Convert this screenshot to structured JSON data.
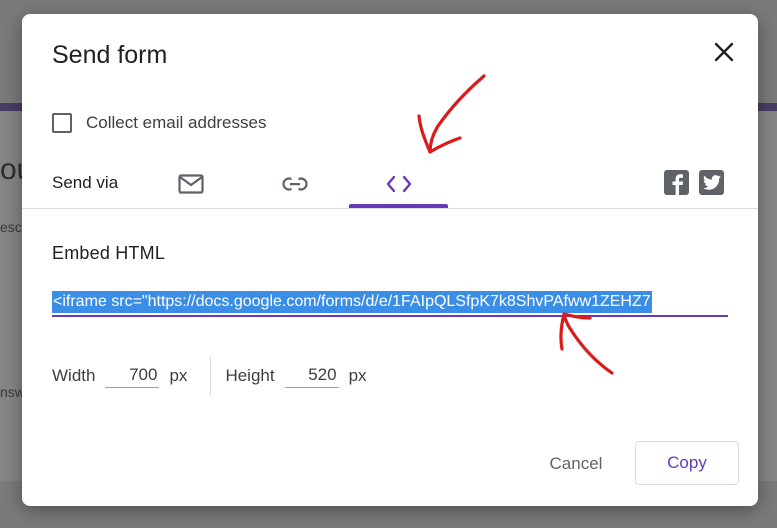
{
  "background": {
    "heading_fragment": "ou",
    "field_fragment_1": "esc",
    "field_fragment_2": "nsw"
  },
  "dialog": {
    "title": "Send form",
    "close_icon": "close-icon",
    "collect_email_label": "Collect email addresses",
    "collect_email_checked": false,
    "send_via_label": "Send via",
    "tabs": [
      {
        "icon": "email-icon",
        "selected": false
      },
      {
        "icon": "link-icon",
        "selected": false
      },
      {
        "icon": "code-icon",
        "selected": true
      }
    ],
    "social": [
      {
        "icon": "facebook-icon"
      },
      {
        "icon": "twitter-icon"
      }
    ],
    "embed_title": "Embed HTML",
    "embed_code": "<iframe src=\"https://docs.google.com/forms/d/e/1FAIpQLSfpK7k8ShvPAfww1ZEHZ7",
    "width_label": "Width",
    "width_value": "700",
    "height_label": "Height",
    "height_value": "520",
    "unit": "px",
    "cancel_label": "Cancel",
    "copy_label": "Copy"
  },
  "colors": {
    "accent": "#673ab7",
    "selection": "#3a8ee6",
    "annotation": "#d81b1b"
  }
}
